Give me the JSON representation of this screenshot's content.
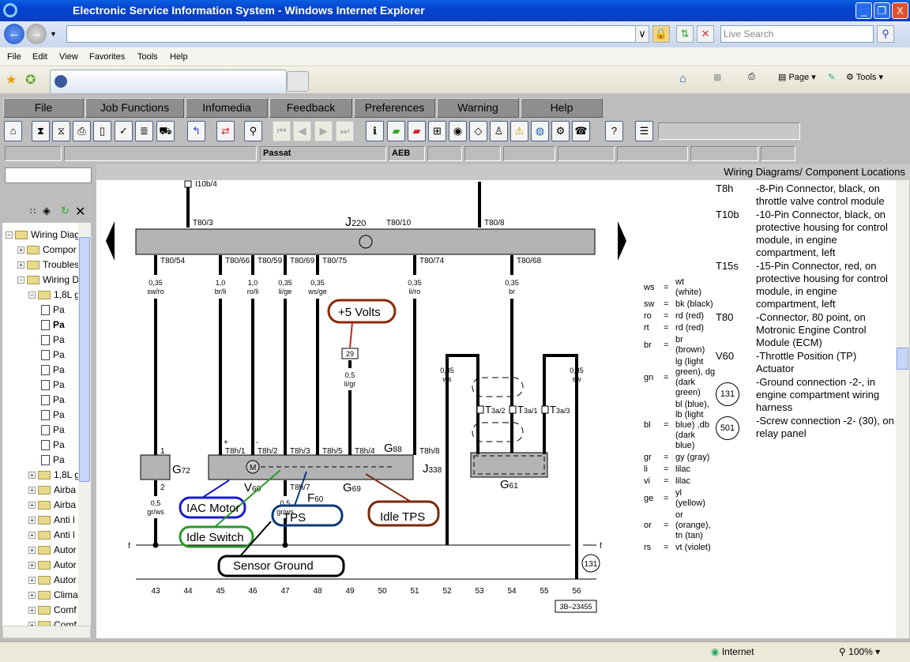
{
  "window": {
    "title": "Electronic Service Information System - Windows Internet Explorer",
    "minimize": "_",
    "restore": "❐",
    "close": "X"
  },
  "browser": {
    "search_placeholder": "Live Search",
    "menu": [
      "File",
      "Edit",
      "View",
      "Favorites",
      "Tools",
      "Help"
    ],
    "commands": {
      "page": "Page",
      "tools": "Tools"
    }
  },
  "app_menu": [
    "File",
    "Job Functions",
    "Infomedia",
    "Feedback",
    "Preferences",
    "Warning",
    "Help"
  ],
  "toolbar_icons": [
    "home-icon",
    "hourglass-icon",
    "hourglass-star-icon",
    "print-icon",
    "new-page-icon",
    "document-check-icon",
    "document-list-icon",
    "car-icon",
    "back-arrow-icon",
    "swap-arrows-icon",
    "magnifier-icon",
    "first-page-icon",
    "prev-page-icon",
    "next-page-icon",
    "last-page-icon",
    "car-info-icon",
    "green-book-icon",
    "red-book-icon",
    "grid-icon",
    "wheel-icon",
    "diagram-icon",
    "people-icon",
    "warning-icon",
    "globe-icon",
    "car-settings-icon",
    "alert-person-icon",
    "help-document-icon",
    "notes-icon"
  ],
  "vehicle": {
    "model": "Passat",
    "engine": "AEB"
  },
  "tree": [
    {
      "label": "Wiring Diag",
      "level": 0,
      "type": "folder-open"
    },
    {
      "label": "Compor",
      "level": 1,
      "type": "folder"
    },
    {
      "label": "Troubles",
      "level": 1,
      "type": "folder"
    },
    {
      "label": "Wiring D",
      "level": 1,
      "type": "folder-open"
    },
    {
      "label": "1,8L g",
      "level": 2,
      "type": "folder-open"
    },
    {
      "label": "Pa",
      "level": 3,
      "type": "page"
    },
    {
      "label": "Pa",
      "level": 3,
      "type": "page",
      "bold": true
    },
    {
      "label": "Pa",
      "level": 3,
      "type": "page"
    },
    {
      "label": "Pa",
      "level": 3,
      "type": "page"
    },
    {
      "label": "Pa",
      "level": 3,
      "type": "page"
    },
    {
      "label": "Pa",
      "level": 3,
      "type": "page"
    },
    {
      "label": "Pa",
      "level": 3,
      "type": "page"
    },
    {
      "label": "Pa",
      "level": 3,
      "type": "page"
    },
    {
      "label": "Pa",
      "level": 3,
      "type": "page"
    },
    {
      "label": "Pa",
      "level": 3,
      "type": "page"
    },
    {
      "label": "Pa",
      "level": 3,
      "type": "page"
    },
    {
      "label": "1,8L g",
      "level": 2,
      "type": "folder"
    },
    {
      "label": "Airba",
      "level": 2,
      "type": "folder"
    },
    {
      "label": "Airba",
      "level": 2,
      "type": "folder"
    },
    {
      "label": "Anti l",
      "level": 2,
      "type": "folder"
    },
    {
      "label": "Anti l",
      "level": 2,
      "type": "folder"
    },
    {
      "label": "Autor",
      "level": 2,
      "type": "folder"
    },
    {
      "label": "Autor",
      "level": 2,
      "type": "folder"
    },
    {
      "label": "Autor",
      "level": 2,
      "type": "folder"
    },
    {
      "label": "Clima",
      "level": 2,
      "type": "folder"
    },
    {
      "label": "Comf",
      "level": 2,
      "type": "folder"
    },
    {
      "label": "Comf",
      "level": 2,
      "type": "folder"
    }
  ],
  "main": {
    "header": "Wiring Diagrams/ Component Locations"
  },
  "diagram": {
    "columns": [
      "43",
      "44",
      "45",
      "46",
      "47",
      "48",
      "49",
      "50",
      "51",
      "52",
      "53",
      "54",
      "55",
      "56"
    ],
    "ecm": {
      "letter": "J",
      "sub": "220",
      "center_pin": "T80/10"
    },
    "ecm_top": [
      {
        "column": "44",
        "pin": "T80/3",
        "connector": "I10b/4"
      },
      {
        "column": "53",
        "pin": "T80/8"
      }
    ],
    "ecm_bottom": [
      {
        "column": "43",
        "pin": "T80/54",
        "size": "0,35",
        "color": "sw/ro"
      },
      {
        "column": "45",
        "pin": "T80/66",
        "size": "1,0",
        "color": "br/li"
      },
      {
        "column": "46",
        "pin": "T80/59",
        "size": "1,0",
        "color": "ro/li"
      },
      {
        "column": "47",
        "pin": "T80/69",
        "size": "0,35",
        "color": "li/ge"
      },
      {
        "column": "48",
        "pin": "T80/75",
        "size": "0,35",
        "color": "ws/ge"
      },
      {
        "column": "51",
        "pin": "T80/74",
        "size": "0,35",
        "color": "li/ro"
      },
      {
        "column": "54",
        "pin": "T80/68",
        "size": "0,35",
        "color": "br"
      }
    ],
    "throttle_pins": [
      {
        "column": "45",
        "pin": "T8h/1",
        "polarity": "+"
      },
      {
        "column": "46",
        "pin": "T8h/2",
        "polarity": "-"
      },
      {
        "column": "47",
        "pin": "T8h/3"
      },
      {
        "column": "48",
        "pin": "T8h/5"
      },
      {
        "column": "49",
        "pin": "T8h/4"
      },
      {
        "column": "51",
        "pin": "T8h/8"
      }
    ],
    "throttle_bottom_pin": "T8h/7",
    "g72_pins": [
      "1",
      "2"
    ],
    "other_wires": [
      {
        "column": "43",
        "size": "0,5",
        "color": "gr/ws"
      },
      {
        "column": "47",
        "size": "0,5",
        "color": "gr/ws"
      },
      {
        "column": "49",
        "size": "0,5",
        "color": "li/gr",
        "splice": "29"
      },
      {
        "column": "52",
        "size": "0,35",
        "color": "ws"
      },
      {
        "column": "56",
        "size": "0,35",
        "color": "sw"
      }
    ],
    "t3a": [
      {
        "column": "53",
        "pin": "3a/2"
      },
      {
        "column": "54",
        "pin": "3a/1"
      },
      {
        "column": "55",
        "pin": "3a/3"
      }
    ],
    "components": [
      {
        "letter": "G",
        "sub": "72"
      },
      {
        "letter": "V",
        "sub": "60"
      },
      {
        "letter": "G",
        "sub": "88"
      },
      {
        "letter": "G",
        "sub": "69"
      },
      {
        "letter": "F",
        "sub": "60"
      },
      {
        "letter": "J",
        "sub": "338"
      },
      {
        "letter": "G",
        "sub": "61"
      }
    ],
    "ground_line": "f",
    "ground_point": "131",
    "ref": "3B–23455",
    "annotations": {
      "volts": "+5 Volts",
      "iac": "IAC Motor",
      "idle_switch": "Idle Switch",
      "tps": "TPS",
      "idle_tps": "Idle TPS",
      "sensor_ground": "Sensor Ground"
    }
  },
  "color_legend": [
    {
      "code": "ws",
      "eq": "=",
      "lines": [
        "wt",
        "(white)"
      ]
    },
    {
      "code": "sw",
      "eq": "=",
      "lines": [
        "bk (black)"
      ]
    },
    {
      "code": "ro",
      "eq": "=",
      "lines": [
        "rd (red)"
      ]
    },
    {
      "code": "rt",
      "eq": "=",
      "lines": [
        "rd (red)"
      ]
    },
    {
      "code": "br",
      "eq": "=",
      "lines": [
        "br",
        "(brown)"
      ]
    },
    {
      "code": "gn",
      "eq": "=",
      "lines": [
        "lg (light",
        "green), dg",
        "(dark",
        "green)"
      ]
    },
    {
      "code": "bl",
      "eq": "=",
      "lines": [
        "bl (blue),",
        "lb (light",
        "blue) ,db",
        "(dark",
        "blue)"
      ]
    },
    {
      "code": "gr",
      "eq": "=",
      "lines": [
        "gy (gray)"
      ]
    },
    {
      "code": "li",
      "eq": "=",
      "lines": [
        "lilac"
      ]
    },
    {
      "code": "vi",
      "eq": "=",
      "lines": [
        "lilac"
      ]
    },
    {
      "code": "ge",
      "eq": "=",
      "lines": [
        "yl",
        "(yellow)"
      ]
    },
    {
      "code": "or",
      "eq": "=",
      "lines": [
        "or",
        "(orange),",
        "tn (tan)"
      ]
    },
    {
      "code": "rs",
      "eq": "=",
      "lines": [
        "vt (violet)"
      ]
    }
  ],
  "component_legend": [
    {
      "code": "T8h",
      "lines": [
        "-8-Pin Connector, black, on",
        "throttle valve control module"
      ]
    },
    {
      "code": "T10b",
      "lines": [
        "-10-Pin Connector, black, on",
        "protective housing for control",
        "module, in engine",
        "compartment, left"
      ]
    },
    {
      "code": "T15s",
      "lines": [
        "-15-Pin Connector, red, on",
        "protective housing for control",
        "module, in engine",
        "compartment, left"
      ]
    },
    {
      "code": "T80",
      "lines": [
        "-Connector, 80 point, on",
        "Motronic Engine Control",
        "Module (ECM)"
      ]
    },
    {
      "code": "V60",
      "lines": [
        "-Throttle Position (TP)",
        "Actuator"
      ]
    },
    {
      "code": "131",
      "circled": true,
      "lines": [
        "-Ground connection -2-, in",
        "engine compartment wiring",
        "harness"
      ]
    },
    {
      "code": "501",
      "circled": true,
      "lines": [
        "-Screw connection -2- (30), on",
        "relay panel"
      ]
    }
  ],
  "status": {
    "zone": "Internet",
    "zoom": "100%"
  },
  "colors": {
    "title_bar": "#0343d0",
    "app_bg": "#bdbdbd",
    "menu_button": "#8e8e8e",
    "annotation_volts": "#8b2a0a",
    "annotation_iac": "#1a1ad0",
    "annotation_idle_switch": "#2a9a2a",
    "annotation_tps": "#0a3a7a",
    "annotation_idle_tps": "#7a2a0a",
    "annotation_sensor_ground": "#000000"
  }
}
